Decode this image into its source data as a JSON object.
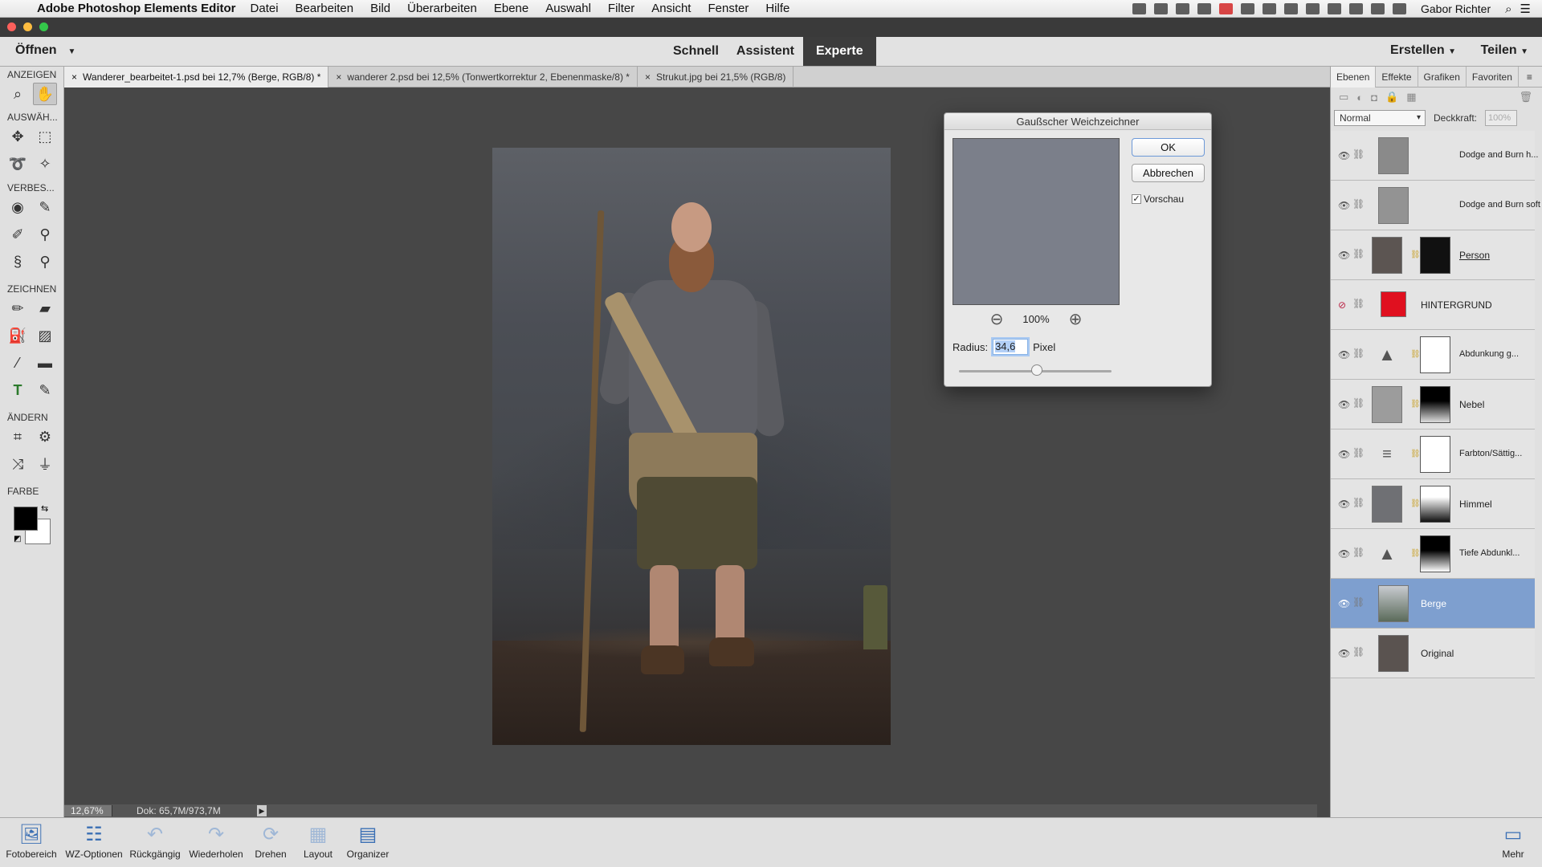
{
  "menubar": {
    "app_name": "Adobe Photoshop Elements Editor",
    "items": [
      "Datei",
      "Bearbeiten",
      "Bild",
      "Überarbeiten",
      "Ebene",
      "Auswahl",
      "Filter",
      "Ansicht",
      "Fenster",
      "Hilfe"
    ],
    "user": "Gabor Richter"
  },
  "topbar": {
    "open_label": "Öffnen",
    "modes": [
      "Schnell",
      "Assistent",
      "Experte"
    ],
    "active_mode": "Experte",
    "create_label": "Erstellen",
    "share_label": "Teilen"
  },
  "toolbox": {
    "sections": [
      "ANZEIGEN",
      "AUSWÄH...",
      "VERBES...",
      "ZEICHNEN",
      "ÄNDERN",
      "FARBE"
    ]
  },
  "doc_tabs": [
    "Wanderer_bearbeitet-1.psd bei 12,7% (Berge, RGB/8) *",
    "wanderer 2.psd bei 12,5% (Tonwertkorrektur 2, Ebenenmaske/8) *",
    "Strukut.jpg bei 21,5% (RGB/8)"
  ],
  "status": {
    "zoom": "12,67%",
    "doc": "Dok: 65,7M/973,7M"
  },
  "dialog": {
    "title": "Gaußscher Weichzeichner",
    "ok_label": "OK",
    "cancel_label": "Abbrechen",
    "preview_label": "Vorschau",
    "preview_checked": true,
    "zoom": "100%",
    "radius_label": "Radius:",
    "radius_value": "34,6",
    "radius_unit": "Pixel"
  },
  "layers_panel": {
    "tabs": [
      "Ebenen",
      "Effekte",
      "Grafiken",
      "Favoriten"
    ],
    "blend_mode": "Normal",
    "opacity_label": "Deckkraft:",
    "opacity_value": "100%",
    "layers": [
      {
        "name": "Dodge and Burn h...",
        "visible": true
      },
      {
        "name": "Dodge and Burn soft",
        "visible": true
      },
      {
        "name": "Person",
        "visible": true
      },
      {
        "name": "HINTERGRUND",
        "visible": false
      },
      {
        "name": "Abdunkung g...",
        "visible": true
      },
      {
        "name": "Nebel",
        "visible": true
      },
      {
        "name": "Farbton/Sättig...",
        "visible": true
      },
      {
        "name": "Himmel",
        "visible": true
      },
      {
        "name": "Tiefe Abdunkl...",
        "visible": true
      },
      {
        "name": "Berge",
        "visible": true,
        "selected": true
      },
      {
        "name": "Original",
        "visible": true
      }
    ]
  },
  "bottombar": {
    "items": [
      "Fotobereich",
      "WZ-Optionen",
      "Rückgängig",
      "Wiederholen",
      "Drehen",
      "Layout",
      "Organizer"
    ],
    "more_label": "Mehr"
  },
  "colors": {
    "accent": "#7e9fcf",
    "hintergrund_fill": "#e0101f"
  }
}
